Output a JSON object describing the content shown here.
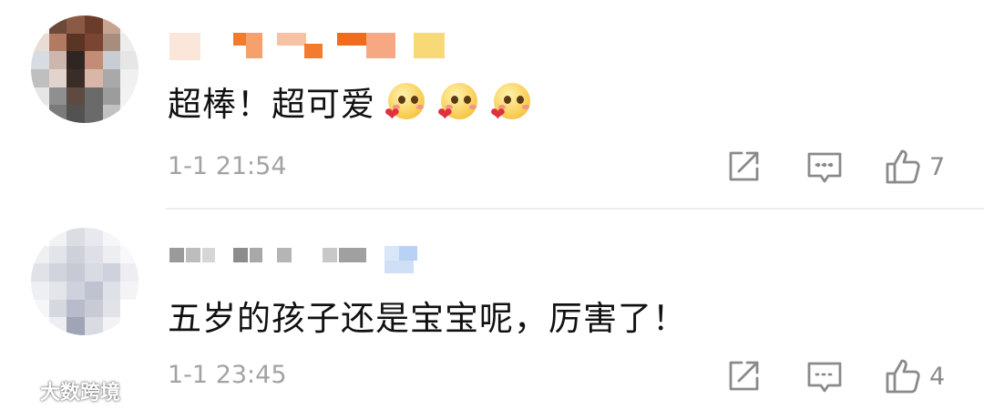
{
  "comments": [
    {
      "text": "超棒！超可爱",
      "emojis": [
        "smiling-heart-emoji",
        "smiling-heart-emoji",
        "smiling-heart-emoji"
      ],
      "date": "1-1",
      "time": "21:54",
      "like_count": "7"
    },
    {
      "text": "五岁的孩子还是宝宝呢，厉害了！",
      "date": "1-1",
      "time": "23:45",
      "like_count": "4"
    }
  ],
  "actions": {
    "share_icon": "share-icon",
    "reply_icon": "reply-icon",
    "like_icon": "thumbs-up-icon"
  },
  "watermark": {
    "text": "大数跨境"
  },
  "colors": {
    "text": "#111111",
    "meta": "#a3a3a3",
    "icon": "#8a8a8a"
  }
}
